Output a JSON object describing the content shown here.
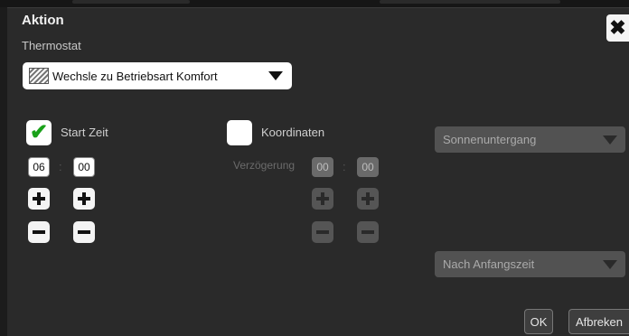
{
  "dialog": {
    "title": "Aktion",
    "subtitle": "Thermostat",
    "close_icon": "close-icon"
  },
  "action_select": {
    "icon": "thermostat-icon",
    "value": "Wechsle zu Betriebsart Komfort"
  },
  "start_time": {
    "label": "Start Zeit",
    "checked": true,
    "hours": "06",
    "minutes": "00",
    "separator": ":"
  },
  "coordinates": {
    "label": "Koordinaten",
    "checked": false,
    "delay_label": "Verzögerung",
    "hours": "00",
    "minutes": "00",
    "separator": ":"
  },
  "sun_select": {
    "value": "Sonnenuntergang"
  },
  "after_select": {
    "value": "Nach Anfangszeit"
  },
  "buttons": {
    "ok": "OK",
    "cancel": "Afbreken"
  },
  "colors": {
    "accent_check": "#1aa11a",
    "background": "#2a2a2a"
  }
}
